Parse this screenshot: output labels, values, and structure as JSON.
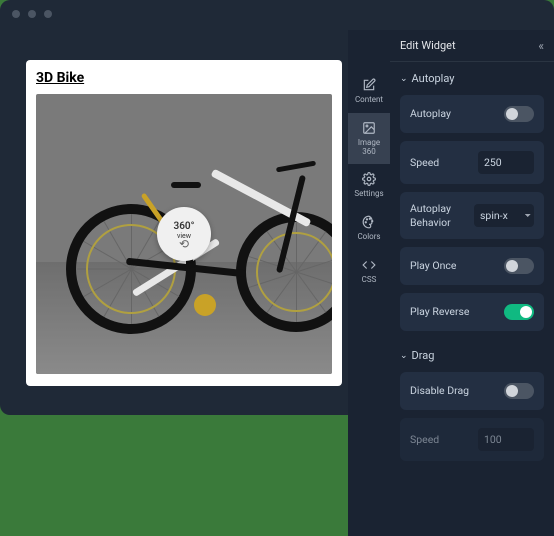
{
  "panel": {
    "title": "Edit Widget"
  },
  "tabs": {
    "content": "Content",
    "image360": "Image\n360",
    "settings": "Settings",
    "colors": "Colors",
    "css": "CSS"
  },
  "canvas": {
    "title": "3D Bike",
    "badge_top": "360°",
    "badge_sub": "view"
  },
  "sections": {
    "autoplay": {
      "title": "Autoplay",
      "autoplay_label": "Autoplay",
      "autoplay_on": false,
      "speed_label": "Speed",
      "speed_value": "250",
      "behavior_label": "Autoplay Behavior",
      "behavior_value": "spin-x",
      "play_once_label": "Play Once",
      "play_once_on": false,
      "play_reverse_label": "Play Reverse",
      "play_reverse_on": true
    },
    "drag": {
      "title": "Drag",
      "disable_label": "Disable Drag",
      "disable_on": false,
      "speed_label": "Speed",
      "speed_value": "100"
    }
  }
}
